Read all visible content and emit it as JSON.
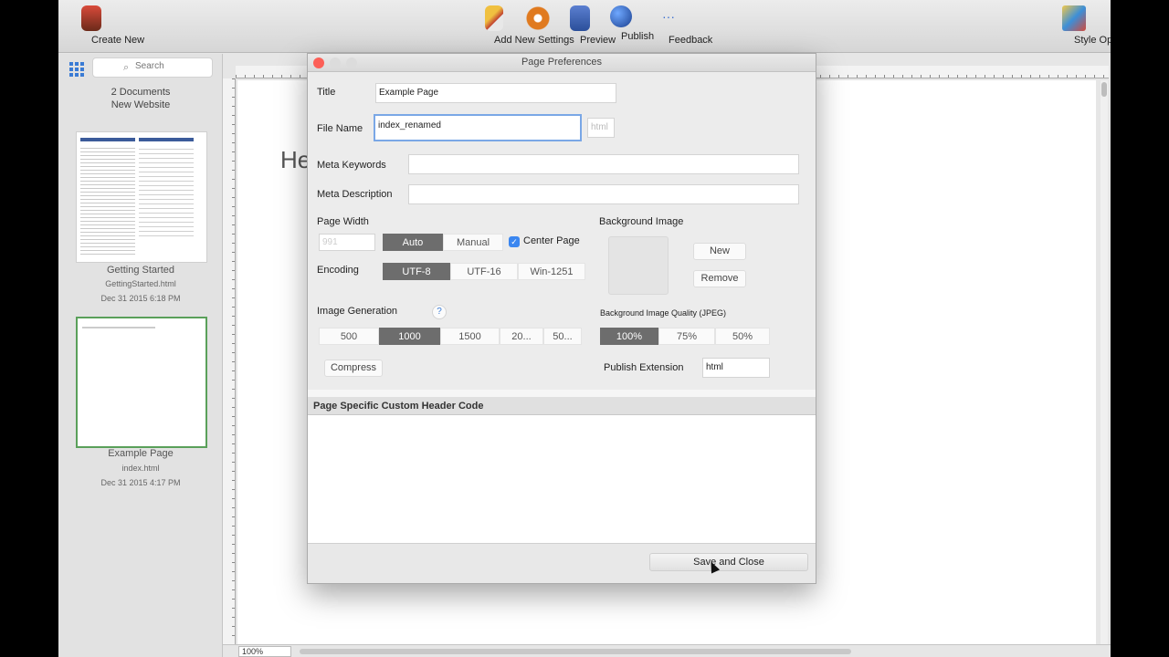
{
  "toolbar": {
    "create_new": "Create New",
    "add_new": "Add New",
    "settings": "Settings",
    "preview": "Preview",
    "publish": "Publish",
    "feedback": "Feedback",
    "feedback_glyph": "···",
    "style_options": "Style Options"
  },
  "sidebar": {
    "search_placeholder": "Search",
    "doc_count": "2 Documents",
    "site_name": "New Website",
    "documents": [
      {
        "name": "Getting Started",
        "file": "GettingStarted.html",
        "date": "Dec 31 2015 6:18 PM"
      },
      {
        "name": "Example Page",
        "file": "index.html",
        "date": "Dec 31 2015 4:17 PM"
      }
    ]
  },
  "canvas": {
    "heading_fragment": "He",
    "zoom": "100%"
  },
  "dialog": {
    "title": "Page Preferences",
    "title_label": "Title",
    "title_value": "Example Page",
    "file_name_label": "File Name",
    "file_name_value": "index_renamed",
    "file_ext_hint": "html",
    "meta_keywords_label": "Meta Keywords",
    "meta_description_label": "Meta Description",
    "page_width_label": "Page Width",
    "page_width_placeholder": "991",
    "width_modes": [
      "Auto",
      "Manual"
    ],
    "center_page_label": "Center Page",
    "center_page_checked": true,
    "encoding_label": "Encoding",
    "encodings": [
      "UTF-8",
      "UTF-16",
      "Win-1251"
    ],
    "image_generation_label": "Image Generation",
    "help_glyph": "?",
    "image_sizes": [
      "500",
      "1000",
      "1500",
      "20...",
      "50..."
    ],
    "compress_label": "Compress",
    "background_image_label": "Background Image",
    "bg_new": "New",
    "bg_remove": "Remove",
    "bg_quality_label": "Background Image Quality (JPEG)",
    "bg_qualities": [
      "100%",
      "75%",
      "50%"
    ],
    "publish_extension_label": "Publish Extension",
    "publish_extension_value": "html",
    "custom_header_label": "Page Specific Custom Header Code",
    "save_close": "Save and Close"
  }
}
